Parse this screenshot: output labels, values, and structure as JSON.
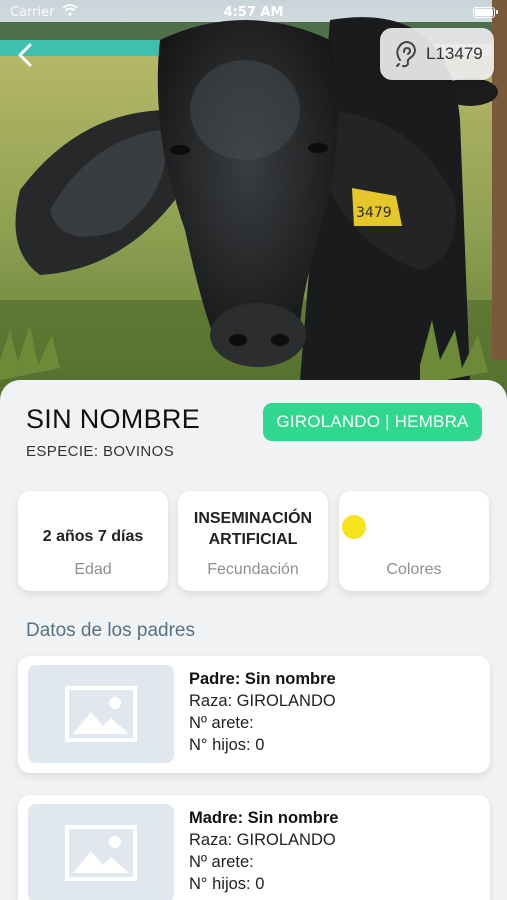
{
  "status_bar": {
    "carrier": "Carrier",
    "time": "4:57 AM"
  },
  "header": {
    "back_icon": "chevron-left-icon",
    "tag_icon": "ear-icon",
    "tag_id": "L13479"
  },
  "photo": {
    "ear_tag_text": "3479"
  },
  "animal": {
    "name": "SIN NOMBRE",
    "species": "ESPECIE: BOVINOS",
    "breed_badge": "GIROLANDO | HEMBRA",
    "badge_color": "#2fd88e"
  },
  "info_cards": {
    "age": {
      "value": "2 años  7 días",
      "label": "Edad"
    },
    "fertilization": {
      "value_line1": "INSEMINACIÓN",
      "value_line2": "ARTIFICIAL",
      "label": "Fecundación"
    },
    "colors": {
      "label": "Colores",
      "swatch": "#f6e31b"
    }
  },
  "parents": {
    "title": "Datos de los padres",
    "father": {
      "name": "Padre: Sin nombre",
      "breed": "Raza: GIROLANDO",
      "tag": "Nº arete:",
      "children": "N° hijos:  0"
    },
    "mother": {
      "name": "Madre: Sin nombre",
      "breed": "Raza: GIROLANDO",
      "tag": "Nº arete:",
      "children": "N° hijos: 0"
    },
    "placeholder_icon": "image-placeholder-icon"
  }
}
